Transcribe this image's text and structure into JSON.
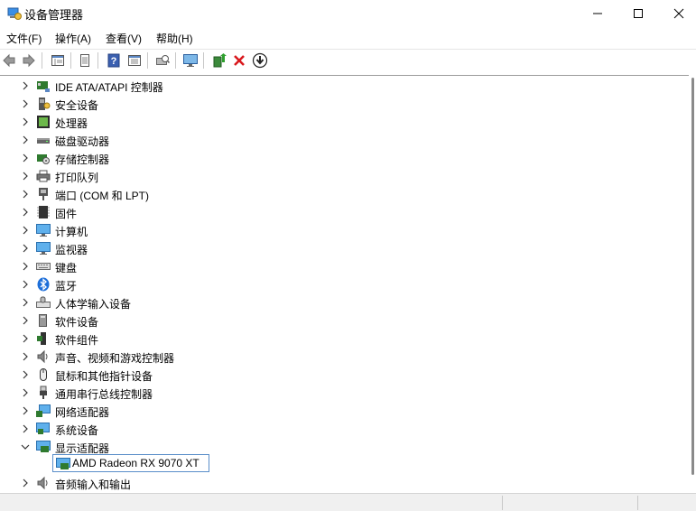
{
  "window": {
    "title": "设备管理器",
    "icon": "device-manager-icon"
  },
  "menu": [
    "文件(F)",
    "操作(A)",
    "查看(V)",
    "帮助(H)"
  ],
  "toolbar": [
    "back-arrow-icon",
    "forward-arrow-icon",
    "properties-view-icon",
    "driver-details-icon",
    "help-icon",
    "view-resources-icon",
    "scan-hardware-icon",
    "monitor-icon",
    "update-driver-icon",
    "uninstall-x-icon",
    "download-icon"
  ],
  "tree": {
    "categories": [
      {
        "label": "IDE ATA/ATAPI 控制器",
        "icon": "ide-controller-icon",
        "expanded": false
      },
      {
        "label": "安全设备",
        "icon": "security-device-icon",
        "expanded": false
      },
      {
        "label": "处理器",
        "icon": "processor-icon",
        "expanded": false
      },
      {
        "label": "磁盘驱动器",
        "icon": "disk-drive-icon",
        "expanded": false
      },
      {
        "label": "存储控制器",
        "icon": "storage-controller-icon",
        "expanded": false
      },
      {
        "label": "打印队列",
        "icon": "printer-icon",
        "expanded": false
      },
      {
        "label": "端口 (COM 和 LPT)",
        "icon": "port-icon",
        "expanded": false
      },
      {
        "label": "固件",
        "icon": "firmware-icon",
        "expanded": false
      },
      {
        "label": "计算机",
        "icon": "computer-icon",
        "expanded": false
      },
      {
        "label": "监视器",
        "icon": "monitor-icon",
        "expanded": false
      },
      {
        "label": "键盘",
        "icon": "keyboard-icon",
        "expanded": false
      },
      {
        "label": "蓝牙",
        "icon": "bluetooth-icon",
        "expanded": false
      },
      {
        "label": "人体学输入设备",
        "icon": "hid-icon",
        "expanded": false
      },
      {
        "label": "软件设备",
        "icon": "software-device-icon",
        "expanded": false
      },
      {
        "label": "软件组件",
        "icon": "software-component-icon",
        "expanded": false
      },
      {
        "label": "声音、视频和游戏控制器",
        "icon": "speaker-icon",
        "expanded": false
      },
      {
        "label": "鼠标和其他指针设备",
        "icon": "mouse-icon",
        "expanded": false
      },
      {
        "label": "通用串行总线控制器",
        "icon": "usb-icon",
        "expanded": false
      },
      {
        "label": "网络适配器",
        "icon": "network-adapter-icon",
        "expanded": false
      },
      {
        "label": "系统设备",
        "icon": "system-device-icon",
        "expanded": false
      },
      {
        "label": "显示适配器",
        "icon": "display-adapter-icon",
        "expanded": true
      },
      {
        "label": "音频输入和输出",
        "icon": "audio-io-icon",
        "expanded": false
      }
    ],
    "selected_device": {
      "label": "AMD Radeon RX 9070 XT",
      "icon": "display-adapter-icon"
    }
  }
}
